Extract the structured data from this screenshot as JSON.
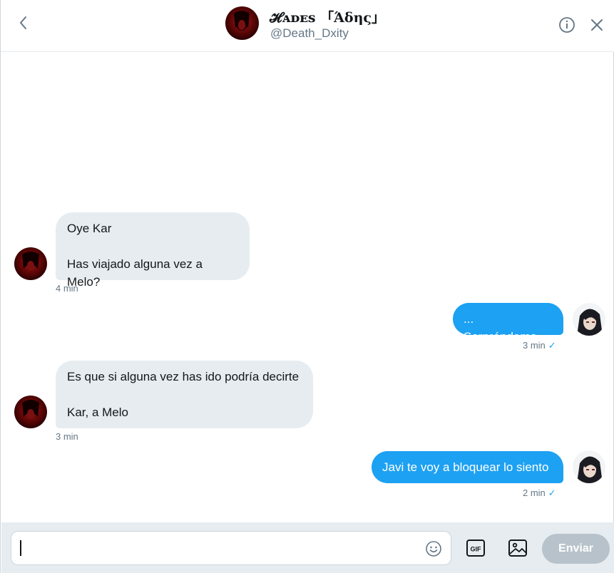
{
  "header": {
    "name": "𝓗ᴀᴅᴇs 「Άδης」",
    "handle": "@Death_Dxity"
  },
  "messages": [
    {
      "direction": "in",
      "text": "Oye Kar\n\nHas viajado alguna vez a Melo?",
      "time": "4 min"
    },
    {
      "direction": "out",
      "text": "... Sorpréndeme.",
      "time": "3 min"
    },
    {
      "direction": "in",
      "text": "Es que si alguna vez has ido podría decirte\n\nKar, a Melo",
      "time": "3 min"
    },
    {
      "direction": "out",
      "text": "Javi te voy a bloquear lo siento",
      "time": "2 min"
    }
  ],
  "composer": {
    "input_value": "",
    "send_label": "Enviar",
    "gif_label": "GIF"
  },
  "colors": {
    "accent": "#1da1f2",
    "incoming_bubble": "#e6ecf0",
    "muted_text": "#657786",
    "send_disabled": "#b8c2ca"
  },
  "icons": [
    "back-chevron-icon",
    "info-icon",
    "close-icon",
    "emoji-icon",
    "gif-icon",
    "image-icon",
    "read-check-icon"
  ]
}
